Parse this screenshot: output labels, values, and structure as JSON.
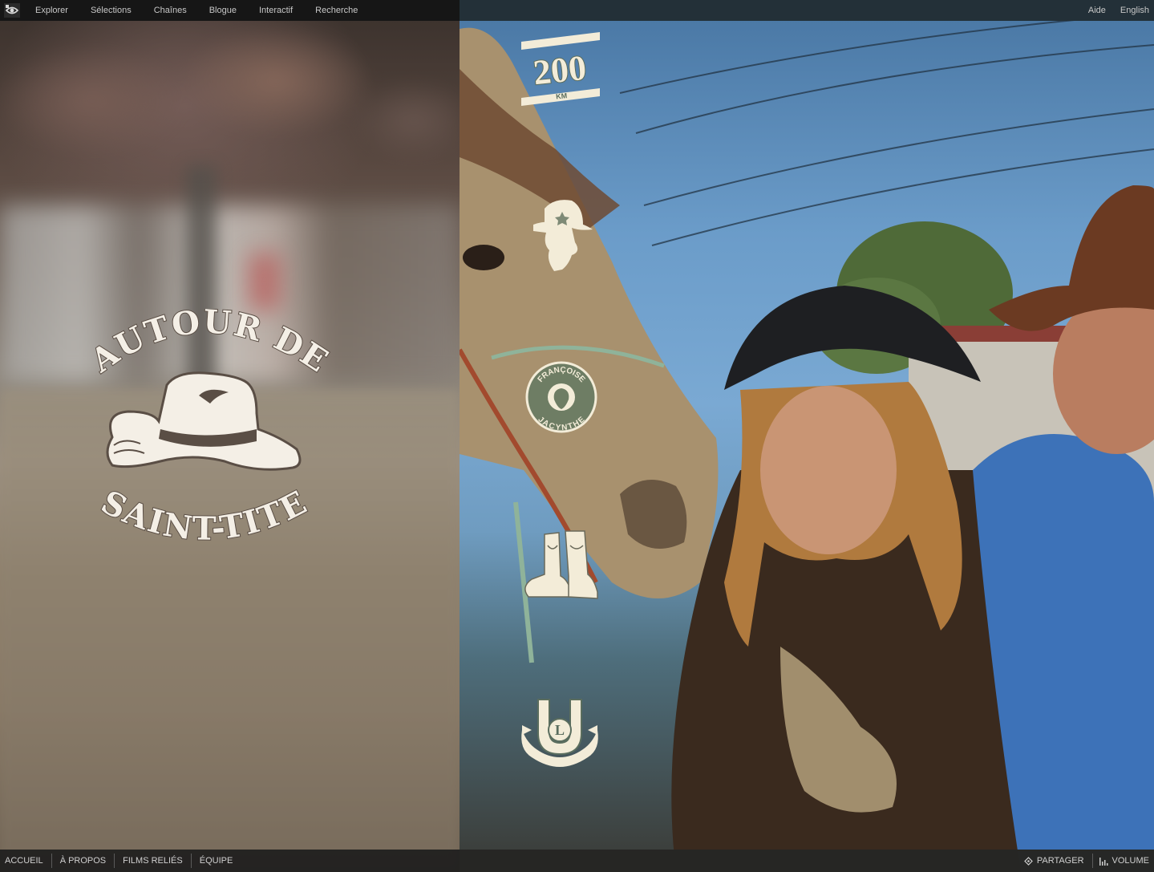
{
  "nav": {
    "logo_icon": "nfb-eye-icon",
    "items": [
      {
        "label": "Explorer"
      },
      {
        "label": "Sélections"
      },
      {
        "label": "Chaînes"
      },
      {
        "label": "Blogue"
      },
      {
        "label": "Interactif"
      },
      {
        "label": "Recherche"
      }
    ],
    "right": [
      {
        "label": "Aide"
      },
      {
        "label": "English"
      }
    ]
  },
  "title": {
    "line1": "AUTOUR DE",
    "line2": "SAINT-TITE",
    "icon": "cowboy-hat-icon"
  },
  "badges": {
    "distance": {
      "number": "200",
      "unit": "KM",
      "icon": "road-sign-icon"
    },
    "cowgirl": {
      "icon": "cowgirl-portrait-icon"
    },
    "francoise": {
      "top": "FRANÇOISE",
      "bottom": "JACYNTHE",
      "icon": "strawberry-medallion-icon"
    },
    "boots": {
      "icon": "cowboy-boots-icon"
    },
    "horseshoe": {
      "letter": "L",
      "icon": "horseshoe-icon"
    }
  },
  "footer": {
    "left": [
      {
        "label": "ACCUEIL"
      },
      {
        "label": "À PROPOS"
      },
      {
        "label": "FILMS RELIÉS"
      },
      {
        "label": "ÉQUIPE"
      }
    ],
    "share": {
      "label": "PARTAGER",
      "icon": "share-icon"
    },
    "volume": {
      "label": "VOLUME",
      "icon": "volume-bars-icon"
    }
  },
  "colors": {
    "badge_cream": "#f3ecd8",
    "badge_outline": "#5a6d5e",
    "title_cream": "#f4efe6"
  }
}
